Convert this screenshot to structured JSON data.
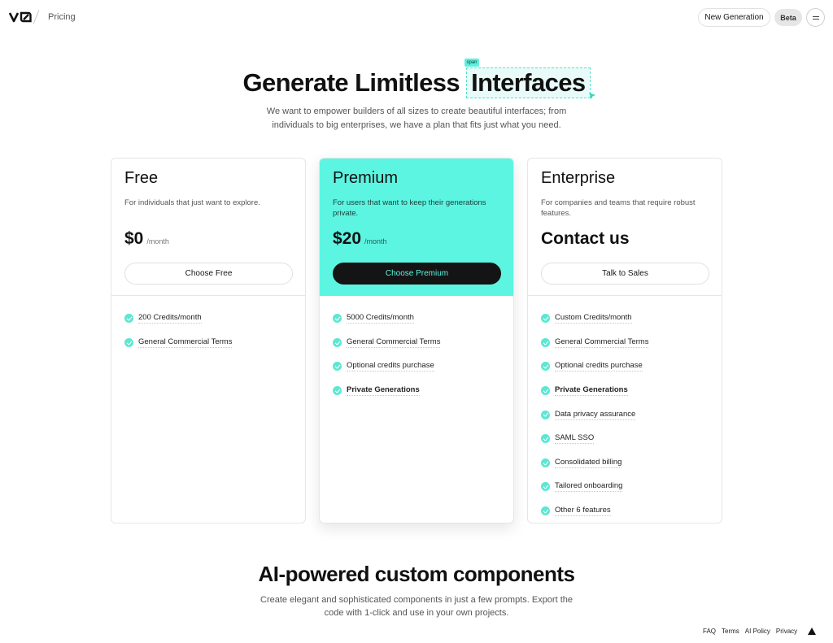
{
  "header": {
    "logo_text": "v0",
    "breadcrumb": "Pricing",
    "new_generation_label": "New Generation",
    "beta_label": "Beta",
    "menu_icon": "menu-icon"
  },
  "hero": {
    "title_start": "Generate Limitless",
    "title_highlight": "Interfaces",
    "span_tag": "span",
    "subtitle": "We want to empower builders of all sizes to create beautiful interfaces; from individuals to big enterprises, we have a plan that fits just what you need."
  },
  "plans": [
    {
      "name": "Free",
      "description": "For individuals that just want to explore.",
      "price": "$0",
      "period": "/month",
      "cta": "Choose Free",
      "features": [
        "200 Credits/month",
        "General Commercial Terms"
      ]
    },
    {
      "name": "Premium",
      "description": "For users that want to keep their generations private.",
      "price": "$20",
      "period": "/month",
      "cta": "Choose Premium",
      "features": [
        "5000 Credits/month",
        "General Commercial Terms",
        "Optional credits purchase",
        "Private Generations"
      ]
    },
    {
      "name": "Enterprise",
      "description": "For companies and teams that require robust features.",
      "price_text": "Contact us",
      "cta": "Talk to Sales",
      "features": [
        "Custom Credits/month",
        "General Commercial Terms",
        "Optional credits purchase",
        "Private Generations",
        "Data privacy assurance",
        "SAML SSO",
        "Consolidated billing",
        "Tailored onboarding",
        "Other 6 features"
      ]
    }
  ],
  "section2": {
    "title": "AI-powered custom components",
    "subtitle": "Create elegant and sophisticated components in just a few prompts. Export the code with 1-click and use in your own projects."
  },
  "footer": {
    "links": [
      "FAQ",
      "Terms",
      "AI Policy",
      "Privacy"
    ]
  },
  "colors": {
    "accent": "#5cf5e1",
    "check": "#5ee6d2",
    "dark_button": "#141414"
  }
}
